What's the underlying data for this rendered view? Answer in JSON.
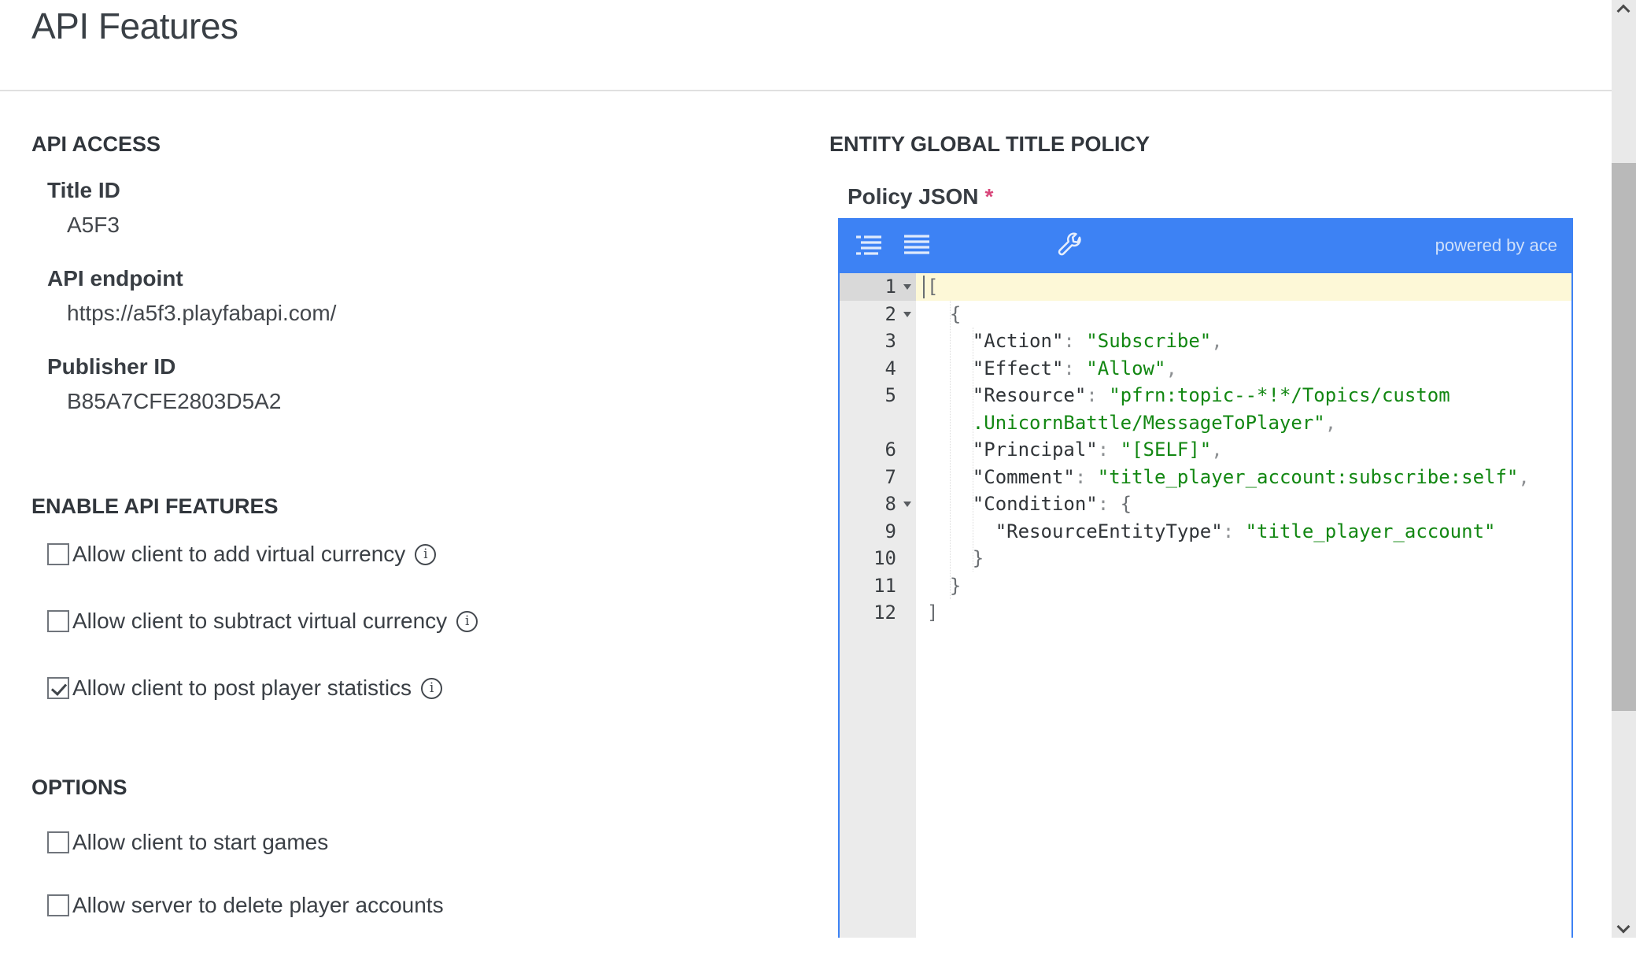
{
  "page": {
    "title": "API Features"
  },
  "colors": {
    "accent_blue": "#3d82f4",
    "string_green": "#128712",
    "required_red": "#d8467a",
    "active_line": "#fdf8d7"
  },
  "api_access": {
    "heading": "API ACCESS",
    "fields": [
      {
        "label": "Title ID",
        "value": "A5F3"
      },
      {
        "label": "API endpoint",
        "value": "https://a5f3.playfabapi.com/"
      },
      {
        "label": "Publisher ID",
        "value": "B85A7CFE2803D5A2"
      }
    ]
  },
  "enable_api_features": {
    "heading": "ENABLE API FEATURES",
    "items": [
      {
        "label": "Allow client to add virtual currency",
        "checked": false,
        "info": true
      },
      {
        "label": "Allow client to subtract virtual currency",
        "checked": false,
        "info": true
      },
      {
        "label": "Allow client to post player statistics",
        "checked": true,
        "info": true
      }
    ]
  },
  "options": {
    "heading": "OPTIONS",
    "items": [
      {
        "label": "Allow client to start games",
        "checked": false,
        "info": false
      },
      {
        "label": "Allow server to delete player accounts",
        "checked": false,
        "info": false
      }
    ]
  },
  "entity_policy": {
    "heading": "ENTITY GLOBAL TITLE POLICY",
    "label": "Policy JSON",
    "required_marker": "*",
    "editor": {
      "powered_by": "powered by ace",
      "toolbar_icons": [
        "auto-format-icon",
        "format-lines-icon",
        "wrench-icon"
      ],
      "lines": [
        {
          "num": "1",
          "fold": true,
          "active": true,
          "tokens": [
            {
              "c": "brace",
              "t": "["
            }
          ]
        },
        {
          "num": "2",
          "fold": true,
          "tokens": [
            {
              "c": "plain",
              "t": "  "
            },
            {
              "c": "brace",
              "t": "{"
            }
          ]
        },
        {
          "num": "3",
          "tokens": [
            {
              "c": "plain",
              "t": "    "
            },
            {
              "c": "key",
              "t": "\"Action\""
            },
            {
              "c": "punct",
              "t": ": "
            },
            {
              "c": "str",
              "t": "\"Subscribe\""
            },
            {
              "c": "punct",
              "t": ","
            }
          ]
        },
        {
          "num": "4",
          "tokens": [
            {
              "c": "plain",
              "t": "    "
            },
            {
              "c": "key",
              "t": "\"Effect\""
            },
            {
              "c": "punct",
              "t": ": "
            },
            {
              "c": "str",
              "t": "\"Allow\""
            },
            {
              "c": "punct",
              "t": ","
            }
          ]
        },
        {
          "num": "5",
          "tokens": [
            {
              "c": "plain",
              "t": "    "
            },
            {
              "c": "key",
              "t": "\"Resource\""
            },
            {
              "c": "punct",
              "t": ": "
            },
            {
              "c": "str",
              "t": "\"pfrn:topic--*!*/Topics/custom"
            }
          ]
        },
        {
          "num": "",
          "tokens": [
            {
              "c": "plain",
              "t": "    "
            },
            {
              "c": "str",
              "t": ".UnicornBattle/MessageToPlayer\""
            },
            {
              "c": "punct",
              "t": ","
            }
          ]
        },
        {
          "num": "6",
          "tokens": [
            {
              "c": "plain",
              "t": "    "
            },
            {
              "c": "key",
              "t": "\"Principal\""
            },
            {
              "c": "punct",
              "t": ": "
            },
            {
              "c": "str",
              "t": "\"[SELF]\""
            },
            {
              "c": "punct",
              "t": ","
            }
          ]
        },
        {
          "num": "7",
          "tokens": [
            {
              "c": "plain",
              "t": "    "
            },
            {
              "c": "key",
              "t": "\"Comment\""
            },
            {
              "c": "punct",
              "t": ": "
            },
            {
              "c": "str",
              "t": "\"title_player_account:subscribe:self\""
            },
            {
              "c": "punct",
              "t": ","
            }
          ]
        },
        {
          "num": "8",
          "fold": true,
          "tokens": [
            {
              "c": "plain",
              "t": "    "
            },
            {
              "c": "key",
              "t": "\"Condition\""
            },
            {
              "c": "punct",
              "t": ": "
            },
            {
              "c": "brace",
              "t": "{"
            }
          ]
        },
        {
          "num": "9",
          "tokens": [
            {
              "c": "plain",
              "t": "      "
            },
            {
              "c": "key",
              "t": "\"ResourceEntityType\""
            },
            {
              "c": "punct",
              "t": ": "
            },
            {
              "c": "str",
              "t": "\"title_player_account\""
            }
          ]
        },
        {
          "num": "10",
          "tokens": [
            {
              "c": "plain",
              "t": "    "
            },
            {
              "c": "brace",
              "t": "}"
            }
          ]
        },
        {
          "num": "11",
          "tokens": [
            {
              "c": "plain",
              "t": "  "
            },
            {
              "c": "brace",
              "t": "}"
            }
          ]
        },
        {
          "num": "12",
          "tokens": [
            {
              "c": "brace",
              "t": "]"
            }
          ]
        }
      ]
    }
  }
}
